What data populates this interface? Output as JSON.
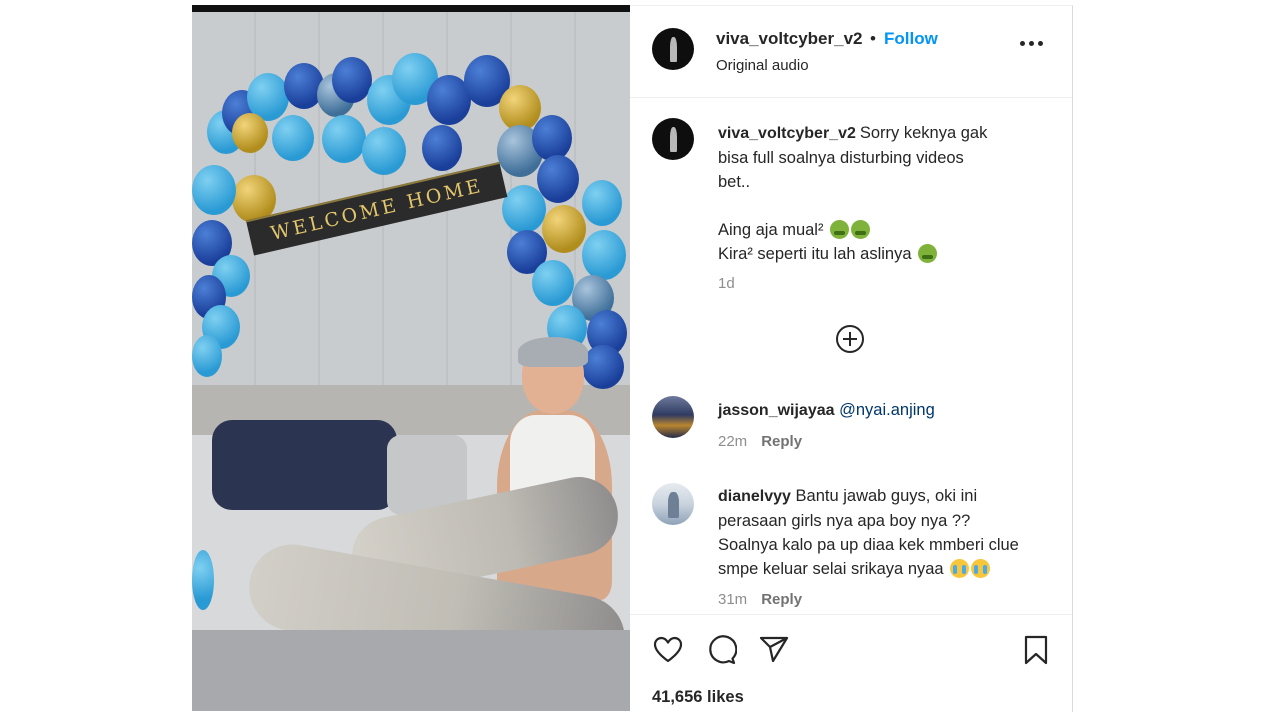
{
  "post": {
    "username": "viva_voltcyber_v2",
    "separator": "•",
    "follow_label": "Follow",
    "audio_label": "Original audio",
    "video_banner_text": "WELCOME HOME"
  },
  "caption": {
    "username": "viva_voltcyber_v2",
    "lines": [
      "Sorry keknya gak",
      "bisa full soalnya disturbing videos",
      "bet..",
      "",
      "Aing aja mual²",
      "Kira² seperti itu lah aslinya"
    ],
    "emojis": [
      "sick-face",
      "sick-face",
      "sick-face"
    ],
    "time": "1d"
  },
  "comments": [
    {
      "username": "jasson_wijayaa",
      "mention": "@nyai.anjing",
      "time": "22m",
      "reply_label": "Reply",
      "avatar": "car-photo"
    },
    {
      "username": "dianelvyy",
      "lines": [
        "Bantu jawab guys, oki ini",
        "perasaan girls nya apa boy nya ??",
        "Soalnya kalo pa up diaa kek mmberi clue",
        "smpe keluar selai srikaya nyaa"
      ],
      "emojis": [
        "crying-face",
        "crying-face"
      ],
      "time": "31m",
      "reply_label": "Reply",
      "avatar": "girl-photo"
    }
  ],
  "actions": {
    "icons": [
      "heart-icon",
      "comment-icon",
      "share-icon",
      "bookmark-icon"
    ]
  },
  "likes": "41,656 likes",
  "colors": {
    "accent": "#0095f6",
    "text": "#262626",
    "muted": "#737373"
  }
}
